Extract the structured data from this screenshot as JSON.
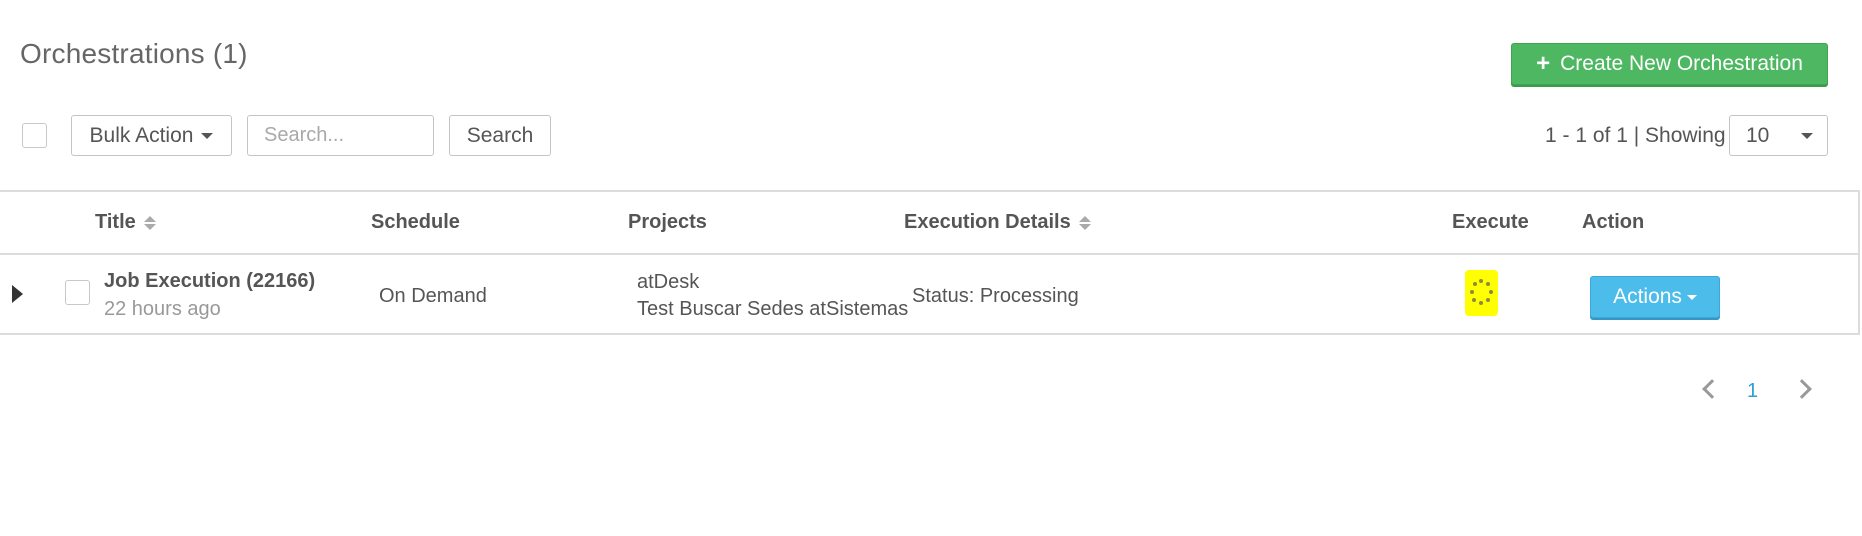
{
  "header": {
    "title": "Orchestrations (1)",
    "create_button": "Create New Orchestration"
  },
  "toolbar": {
    "bulk_action": "Bulk Action",
    "search_placeholder": "Search...",
    "search_button": "Search",
    "pager_info": "1 - 1 of 1 | Showing",
    "page_size": "10"
  },
  "table": {
    "columns": [
      "Title",
      "Schedule",
      "Projects",
      "Execution Details",
      "Execute",
      "Action"
    ],
    "rows": [
      {
        "title": "Job Execution (22166)",
        "time": "22 hours ago",
        "schedule": "On Demand",
        "projects": [
          "atDesk",
          "Test Buscar Sedes atSistemas"
        ],
        "status": "Status: Processing",
        "action": "Actions"
      }
    ]
  },
  "pagination": {
    "current": "1"
  },
  "colors": {
    "create_button": "#4db861",
    "actions_button": "#4cbceb",
    "execute_highlight": "#ffff00",
    "active_page": "#2f9ed6"
  }
}
